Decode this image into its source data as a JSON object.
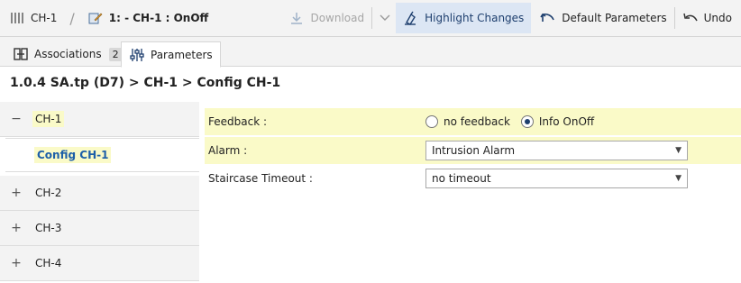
{
  "toolbar": {
    "channel": "CH-1",
    "device_title": "1: - CH-1 : OnOff",
    "download": "Download",
    "highlight_changes": "Highlight Changes",
    "default_parameters": "Default Parameters",
    "undo": "Undo"
  },
  "tabs": [
    {
      "label": "Associations",
      "count": "2"
    },
    {
      "label": "Parameters"
    }
  ],
  "breadcrumb": "1.0.4 SA.tp (D7) > CH-1 > Config CH-1",
  "tree": {
    "items": [
      {
        "label": "CH-1",
        "sign": "−"
      },
      {
        "label": "Config CH-1"
      },
      {
        "label": "CH-2",
        "sign": "+"
      },
      {
        "label": "CH-3",
        "sign": "+"
      },
      {
        "label": "CH-4",
        "sign": "+"
      }
    ]
  },
  "params": {
    "feedback": {
      "label": "Feedback :",
      "options": [
        "no feedback",
        "Info OnOff"
      ],
      "selected": "Info OnOff"
    },
    "alarm": {
      "label": "Alarm :",
      "value": "Intrusion Alarm"
    },
    "staircase": {
      "label": "Staircase Timeout :",
      "value": "no timeout"
    }
  },
  "colors": {
    "highlight": "#fafac8",
    "accent": "#1e3f6e",
    "link": "#1d5fa8"
  }
}
